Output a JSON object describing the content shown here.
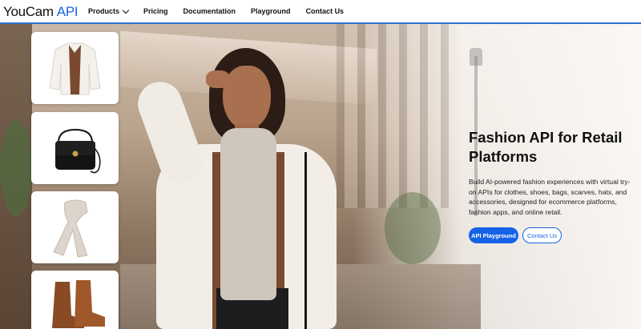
{
  "header": {
    "logo_brand": "YouCam",
    "logo_api": "API",
    "nav": [
      {
        "label": "Products",
        "has_dropdown": true
      },
      {
        "label": "Pricing"
      },
      {
        "label": "Documentation"
      },
      {
        "label": "Playground"
      },
      {
        "label": "Contact Us"
      }
    ]
  },
  "hero": {
    "headline": "Fashion API for Retail Platforms",
    "description": "Build AI-powered fashion experiences with virtual try-on APIs for clothes, shoes, bags, scarves, hats, and accessories, designed for ecommerce platforms, fashion apps, and online retail.",
    "primary_button": "API Playground",
    "secondary_button": "Contact Us",
    "thumbnails": [
      "white-jacket",
      "black-handbag",
      "beige-scarf",
      "brown-boots"
    ]
  },
  "colors": {
    "accent": "#1463e6",
    "nav_border": "#2f6fd6"
  }
}
